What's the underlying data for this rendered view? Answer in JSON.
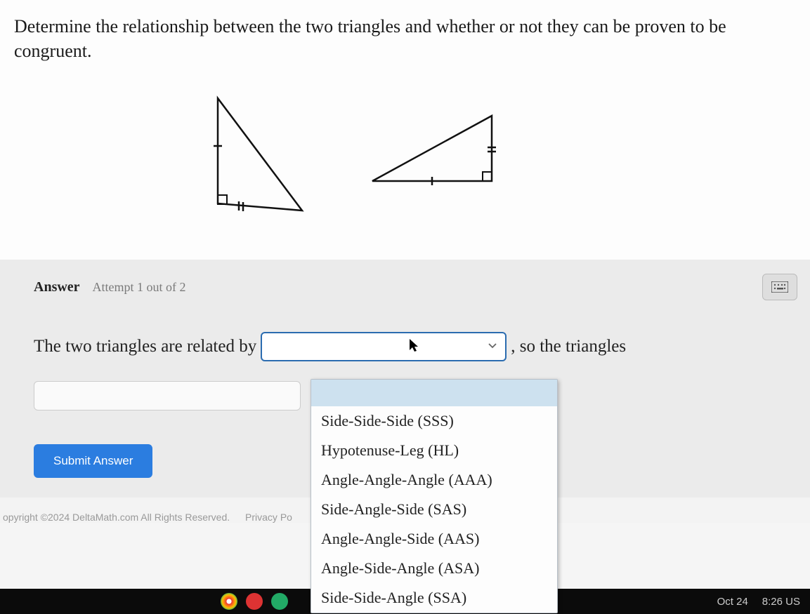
{
  "question": "Determine the relationship between the two triangles and whether or not they can be proven to be congruent.",
  "answer": {
    "label": "Answer",
    "attempt": "Attempt 1 out of 2",
    "sentence_part1": "The two triangles are related by",
    "sentence_part2": ", so the triangles",
    "submit": "Submit Answer"
  },
  "dropdown": {
    "options": [
      "",
      "Side-Side-Side (SSS)",
      "Hypotenuse-Leg (HL)",
      "Angle-Angle-Angle (AAA)",
      "Side-Angle-Side (SAS)",
      "Angle-Angle-Side (AAS)",
      "Angle-Side-Angle (ASA)",
      "Side-Side-Angle (SSA)"
    ]
  },
  "footer": {
    "copyright": "opyright ©2024 DeltaMath.com All Rights Reserved.",
    "privacy": "Privacy Po"
  },
  "taskbar": {
    "date": "Oct 24",
    "time": "8:26 US"
  }
}
